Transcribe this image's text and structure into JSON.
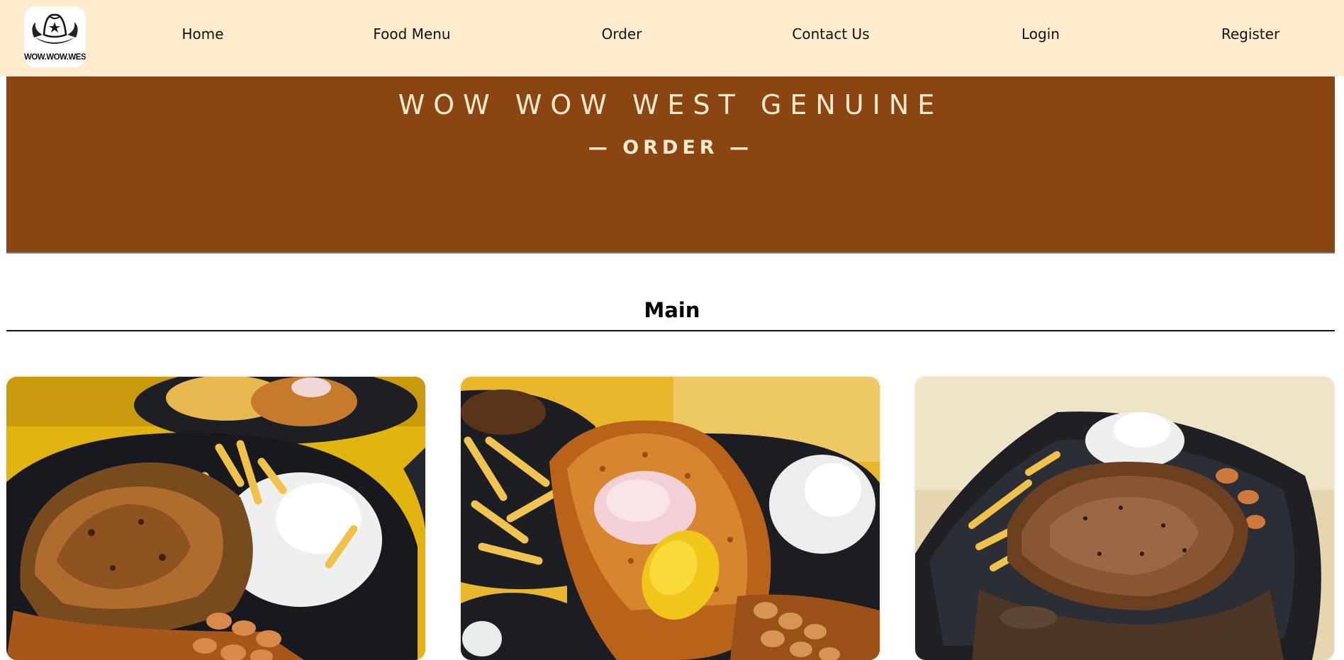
{
  "nav": {
    "logo_text": "WOW.WOW.WEST",
    "links": [
      "Home",
      "Food Menu",
      "Order",
      "Contact Us",
      "Login",
      "Register"
    ]
  },
  "hero": {
    "title": "WOW WOW WEST GENUINE",
    "subtitle": "— ORDER —"
  },
  "section": {
    "title": "Main"
  },
  "colors": {
    "nav_bg": "#ffebcd",
    "hero_bg": "#8b4513",
    "hero_text": "#ffebcd"
  },
  "cards": [
    {
      "image": "grilled-chicken-chop-photo"
    },
    {
      "image": "fish-and-chips-photo"
    },
    {
      "image": "pork-chop-with-gravy-photo"
    }
  ]
}
